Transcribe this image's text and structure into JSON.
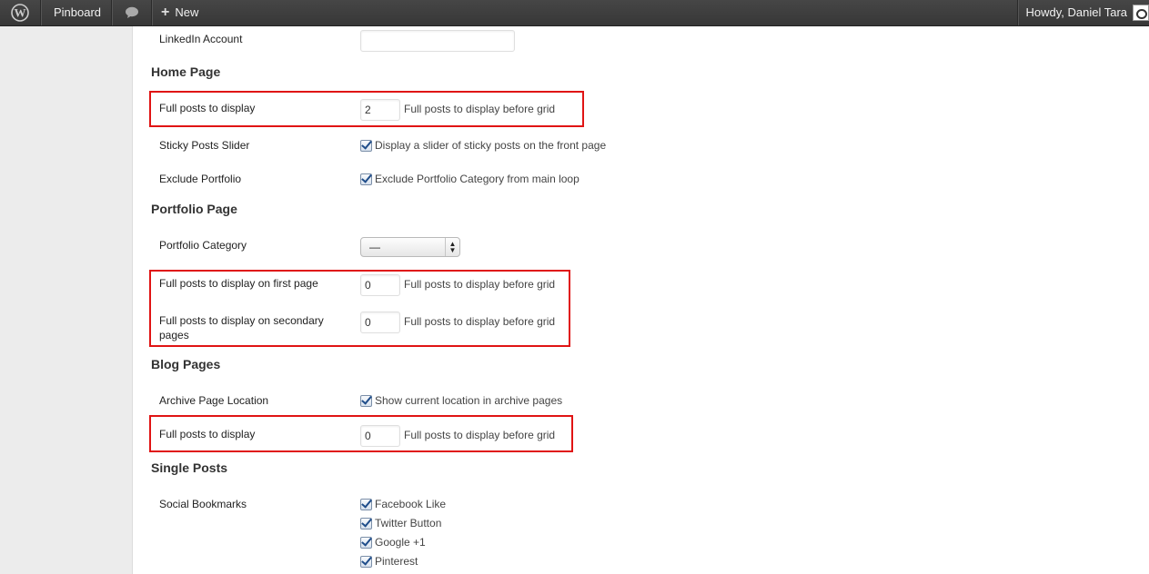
{
  "admin_bar": {
    "site_name": "Pinboard",
    "new_label": "New",
    "greeting": "Howdy, Daniel Tara"
  },
  "fields": {
    "linkedin_label": "LinkedIn Account",
    "linkedin_value": ""
  },
  "home_page": {
    "heading": "Home Page",
    "full_posts_label": "Full posts to display",
    "full_posts_value": "2",
    "full_posts_desc": "Full posts to display before grid",
    "sticky_label": "Sticky Posts Slider",
    "sticky_desc": "Display a slider of sticky posts on the front page",
    "sticky_checked": true,
    "exclude_label": "Exclude Portfolio",
    "exclude_desc": "Exclude Portfolio Category from main loop",
    "exclude_checked": true
  },
  "portfolio_page": {
    "heading": "Portfolio Page",
    "category_label": "Portfolio Category",
    "category_value": "—",
    "first_page_label": "Full posts to display on first page",
    "first_page_value": "0",
    "first_page_desc": "Full posts to display before grid",
    "secondary_label": "Full posts to display on secondary pages",
    "secondary_value": "0",
    "secondary_desc": "Full posts to display before grid"
  },
  "blog_pages": {
    "heading": "Blog Pages",
    "archive_label": "Archive Page Location",
    "archive_desc": "Show current location in archive pages",
    "archive_checked": true,
    "full_posts_label": "Full posts to display",
    "full_posts_value": "0",
    "full_posts_desc": "Full posts to display before grid"
  },
  "single_posts": {
    "heading": "Single Posts",
    "social_label": "Social Bookmarks",
    "social_options": [
      {
        "label": "Facebook Like",
        "checked": true
      },
      {
        "label": "Twitter Button",
        "checked": true
      },
      {
        "label": "Google +1",
        "checked": true
      },
      {
        "label": "Pinterest",
        "checked": true
      }
    ]
  },
  "colors": {
    "admin_bar": "#464646",
    "highlight": "#e01414",
    "checkbox_mark": "#1f4d8a"
  },
  "icons": {
    "wp_logo": "wordpress-logo-icon",
    "comments": "comment-bubble-icon",
    "new": "plus-icon",
    "checkbox": "checkmark-icon",
    "select": "updown-arrows-icon"
  }
}
